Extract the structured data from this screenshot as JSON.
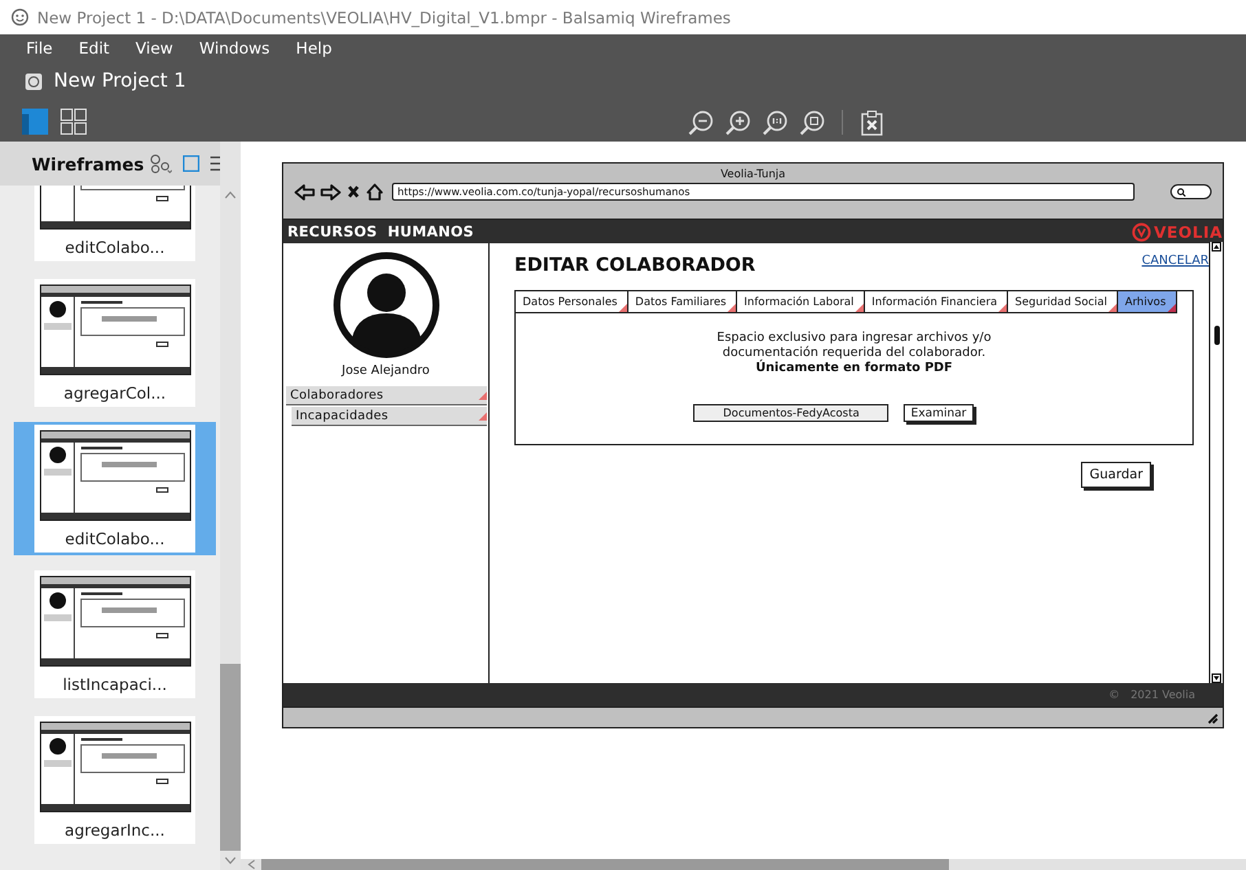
{
  "window": {
    "title": "New Project 1 - D:\\DATA\\Documents\\VEOLIA\\HV_Digital_V1.bmpr - Balsamiq Wireframes"
  },
  "menu": [
    "File",
    "Edit",
    "View",
    "Windows",
    "Help"
  ],
  "project": {
    "title": "New Project 1"
  },
  "toolbar": {
    "views": [
      {
        "kind": "single",
        "selected": true
      },
      {
        "kind": "grid",
        "selected": false
      }
    ]
  },
  "sidebar": {
    "title": "Wireframes",
    "pages": [
      {
        "label": "editColabo...",
        "selected": false
      },
      {
        "label": "agregarCol...",
        "selected": false
      },
      {
        "label": "editColabo...",
        "selected": true
      },
      {
        "label": "listIncapaci...",
        "selected": false
      },
      {
        "label": "agregarInc...",
        "selected": false
      }
    ]
  },
  "mockup": {
    "browser": {
      "title": "Veolia-Tunja",
      "url": "https://www.veolia.com.co/tunja-yopal/recursoshumanos"
    },
    "header": {
      "title": "RECURSOS  HUMANOS",
      "logo": "VEOLIA"
    },
    "profile": {
      "name": "Jose Alejandro"
    },
    "nav": [
      "Colaboradores",
      "Incapacidades"
    ],
    "heading": "EDITAR COLABORADOR",
    "cancel": "CANCELAR",
    "tabs": [
      {
        "label": "Datos Personales",
        "selected": false
      },
      {
        "label": "Datos Familiares",
        "selected": false
      },
      {
        "label": "Información Laboral",
        "selected": false
      },
      {
        "label": "Información Financiera",
        "selected": false
      },
      {
        "label": "Seguridad Social",
        "selected": false
      },
      {
        "label": "Arhivos",
        "selected": true
      }
    ],
    "description": "Espacio exclusivo para ingresar archivos y/o documentación requerida del colaborador.",
    "note": "Únicamente en formato PDF",
    "file_field": {
      "value": "Documentos-FedyAcosta"
    },
    "browse_button": "Examinar",
    "save_button": "Guardar",
    "footer": {
      "symbol": "©",
      "text": "2021 Veolia"
    }
  }
}
